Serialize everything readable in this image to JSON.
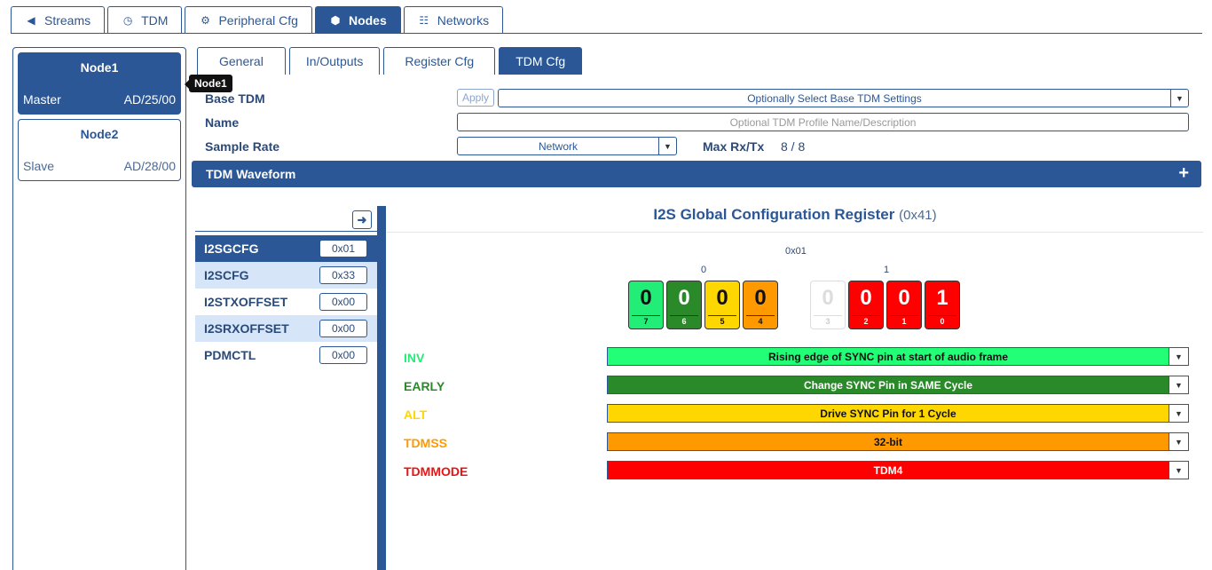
{
  "top_tabs": [
    {
      "label": "Streams",
      "icon": "speaker-icon"
    },
    {
      "label": "TDM",
      "icon": "clock-icon"
    },
    {
      "label": "Peripheral Cfg",
      "icon": "gear-icon"
    },
    {
      "label": "Nodes",
      "icon": "cube-icon",
      "active": true
    },
    {
      "label": "Networks",
      "icon": "network-icon"
    }
  ],
  "nodes": [
    {
      "name": "Node1",
      "role": "Master",
      "address": "AD/25/00",
      "active": true
    },
    {
      "name": "Node2",
      "role": "Slave",
      "address": "AD/28/00",
      "active": false
    }
  ],
  "tooltip": "Node1",
  "sub_tabs": [
    {
      "label": "General"
    },
    {
      "label": "In/Outputs"
    },
    {
      "label": "Register Cfg"
    },
    {
      "label": "TDM Cfg",
      "active": true
    }
  ],
  "form": {
    "base_tdm_label": "Base TDM",
    "apply_label": "Apply",
    "base_tdm_select": "Optionally Select Base TDM Settings",
    "name_label": "Name",
    "name_placeholder": "Optional TDM Profile Name/Description",
    "sample_rate_label": "Sample Rate",
    "sample_rate_value": "Network",
    "max_rxtx_label": "Max Rx/Tx",
    "max_rxtx_value": "8 / 8"
  },
  "waveform": {
    "label": "TDM Waveform",
    "plus": "+"
  },
  "registers": [
    {
      "name": "I2SGCFG",
      "value": "0x01"
    },
    {
      "name": "I2SCFG",
      "value": "0x33"
    },
    {
      "name": "I2STXOFFSET",
      "value": "0x00"
    },
    {
      "name": "I2SRXOFFSET",
      "value": "0x00"
    },
    {
      "name": "PDMCTL",
      "value": "0x00"
    }
  ],
  "register_detail": {
    "title": "I2S Global Configuration Register",
    "address": "(0x41)",
    "hex": "0x01",
    "nibble_high": "0",
    "nibble_low": "1",
    "bits": [
      {
        "value": "0",
        "index": "7",
        "color": "#22ee77"
      },
      {
        "value": "0",
        "index": "6",
        "color": "#2a8a2a"
      },
      {
        "value": "0",
        "index": "5",
        "color": "#ffd700"
      },
      {
        "value": "0",
        "index": "4",
        "color": "#ff9900"
      },
      {
        "value": "0",
        "index": "3",
        "color": "#ffffff"
      },
      {
        "value": "0",
        "index": "2",
        "color": "#ff0000"
      },
      {
        "value": "0",
        "index": "1",
        "color": "#ff0000"
      },
      {
        "value": "1",
        "index": "0",
        "color": "#ff0000"
      }
    ],
    "fields": [
      {
        "name": "INV",
        "value": "Rising edge of SYNC pin at start of audio frame",
        "color": "#22ee77",
        "bg": "#22ff77"
      },
      {
        "name": "EARLY",
        "value": "Change SYNC Pin in SAME Cycle",
        "color": "#2a8a2a",
        "bg": "#2a8a2a"
      },
      {
        "name": "ALT",
        "value": "Drive SYNC Pin for 1 Cycle",
        "color": "#ffd700",
        "bg": "#ffd700"
      },
      {
        "name": "TDMSS",
        "value": "32-bit",
        "color": "#ff9900",
        "bg": "#ff9900"
      },
      {
        "name": "TDMMODE",
        "value": "TDM4",
        "color": "#ee1111",
        "bg": "#ff0000"
      }
    ]
  }
}
